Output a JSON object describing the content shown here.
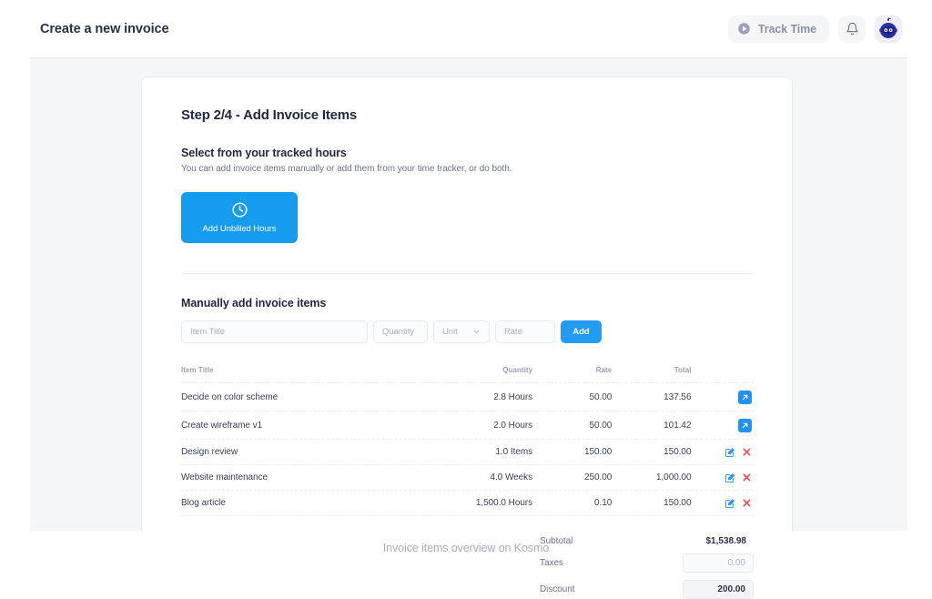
{
  "header": {
    "title": "Create a new invoice",
    "track_time_label": "Track Time",
    "play_icon": "play-circle-icon",
    "bell_icon": "bell-icon",
    "avatar_icon": "robot-avatar-icon"
  },
  "card": {
    "step_title": "Step 2/4 - Add Invoice Items",
    "tracked_heading": "Select from your tracked hours",
    "tracked_description": "You can add invoice items manually or add them from your time tracker, or do both.",
    "unbilled_button": {
      "label": "Add Unbilled Hours",
      "icon": "clock-icon",
      "color": "#159cee"
    },
    "manual_heading": "Manually add invoice items",
    "manual_form": {
      "item_title_placeholder": "Item Title",
      "quantity_placeholder": "Quantity",
      "unit_placeholder": "Unit",
      "rate_placeholder": "Rate",
      "add_label": "Add",
      "add_color": "#229cf0",
      "chevron_icon": "chevron-down-icon"
    },
    "table": {
      "columns": [
        "Item Title",
        "Quantity",
        "Rate",
        "Total",
        ""
      ],
      "rows": [
        {
          "title": "Decide on color scheme",
          "quantity": "2.8 Hours",
          "rate": "50.00",
          "total": "137.56",
          "actions": [
            "external-link-icon"
          ]
        },
        {
          "title": "Create wireframe v1",
          "quantity": "2.0 Hours",
          "rate": "50.00",
          "total": "101.42",
          "actions": [
            "external-link-icon"
          ]
        },
        {
          "title": "Design review",
          "quantity": "1.0 Items",
          "rate": "150.00",
          "total": "150.00",
          "actions": [
            "edit-icon",
            "delete-icon"
          ]
        },
        {
          "title": "Website maintenance",
          "quantity": "4.0 Weeks",
          "rate": "250.00",
          "total": "1,000.00",
          "actions": [
            "edit-icon",
            "delete-icon"
          ]
        },
        {
          "title": "Blog article",
          "quantity": "1,500.0 Hours",
          "rate": "0.10",
          "total": "150.00",
          "actions": [
            "edit-icon",
            "delete-icon"
          ]
        }
      ]
    },
    "totals": {
      "subtotal_label": "Subtotal",
      "subtotal_value": "$1,538.98",
      "taxes_label": "Taxes",
      "taxes_value": "0.00",
      "discount_label": "Discount",
      "discount_value": "200.00"
    }
  },
  "caption": "Invoice items overview on Kosmo"
}
